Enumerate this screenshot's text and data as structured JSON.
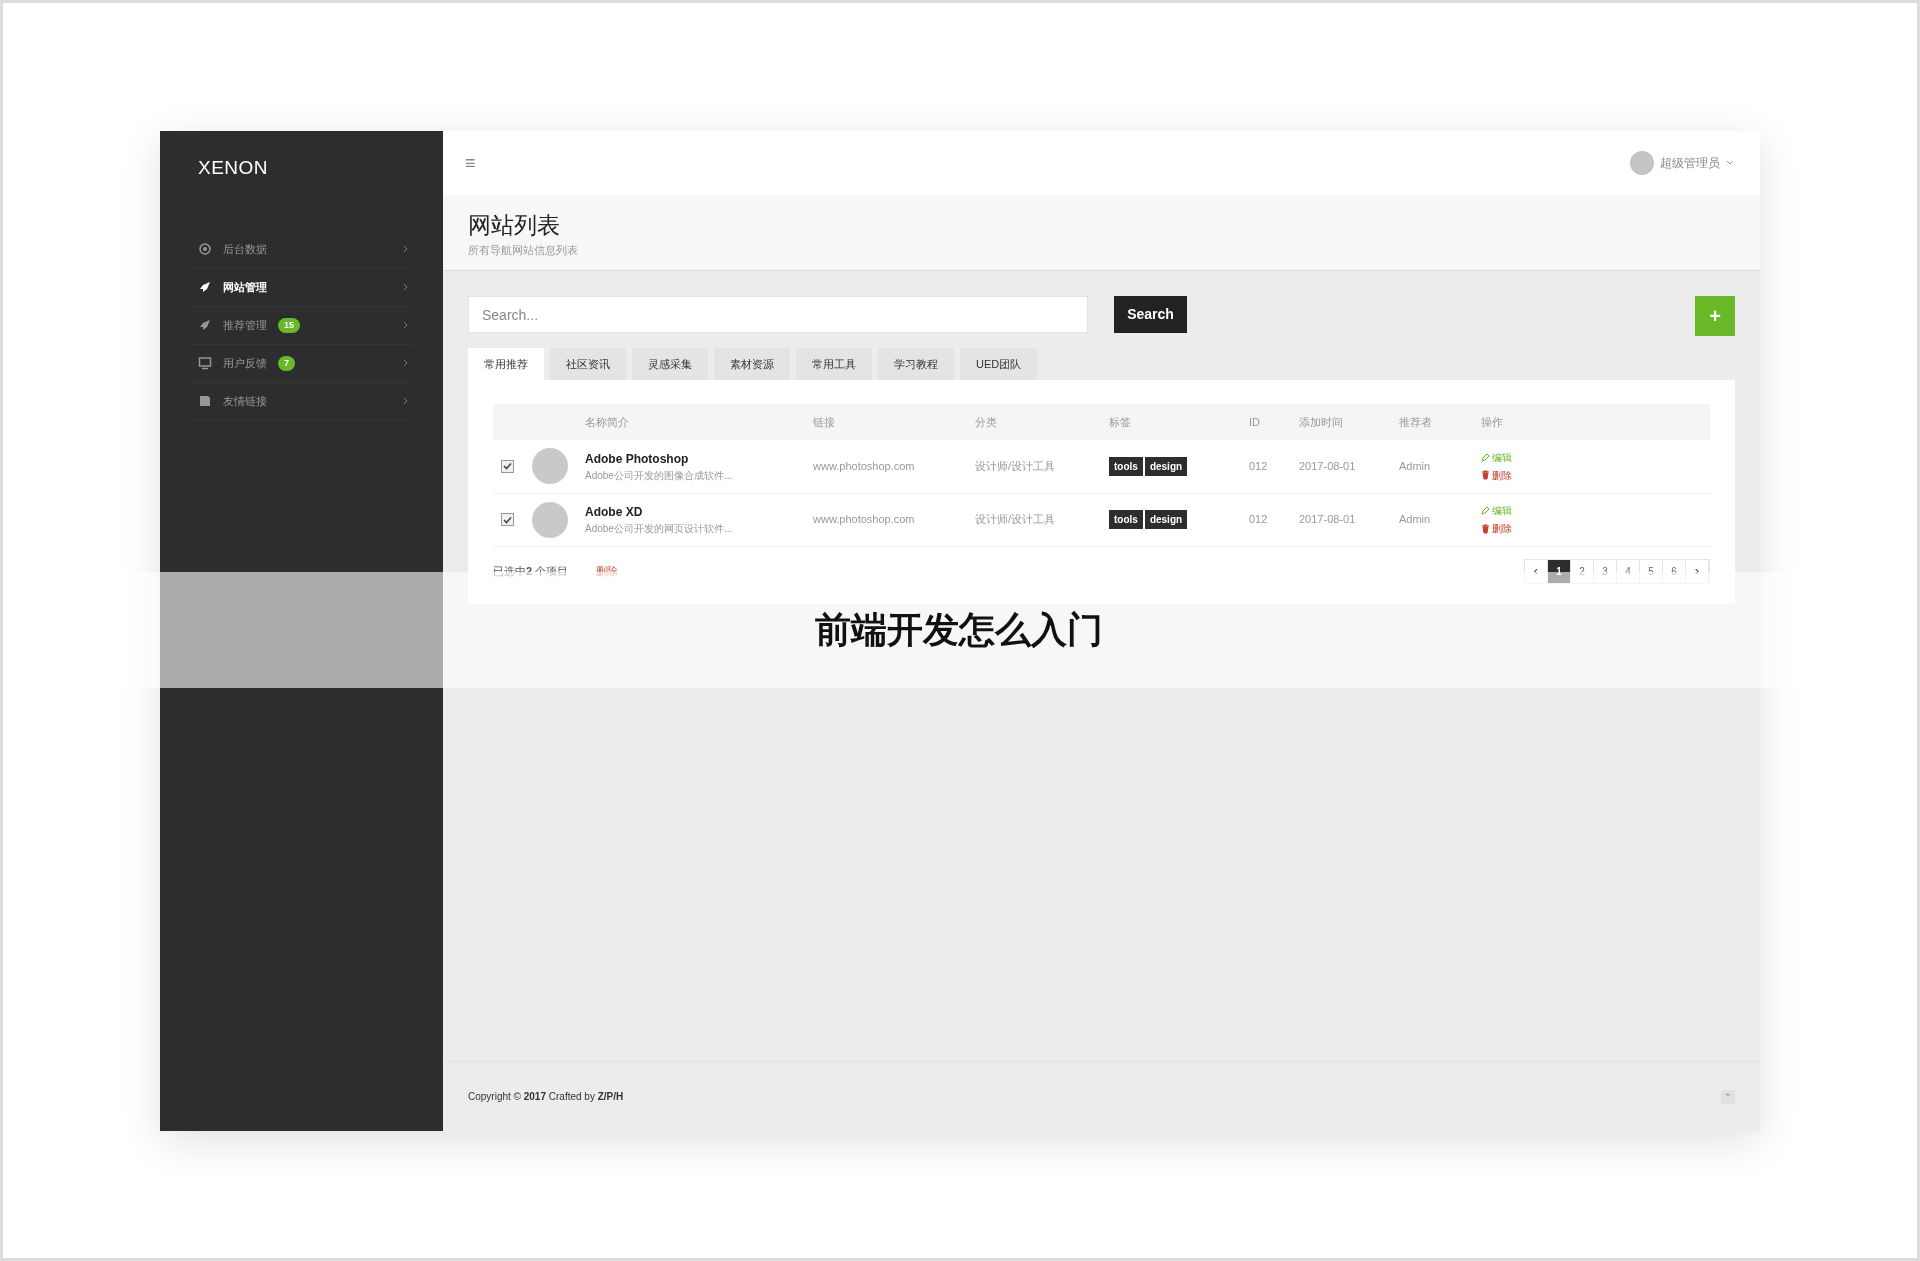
{
  "logo": "XENON",
  "sidebar": {
    "items": [
      {
        "label": "后台数据",
        "selected": false
      },
      {
        "label": "网站管理",
        "selected": true
      },
      {
        "label": "推荐管理",
        "selected": false,
        "badge": "15"
      },
      {
        "label": "用户反馈",
        "selected": false,
        "badge": "7"
      },
      {
        "label": "友情链接",
        "selected": false
      }
    ]
  },
  "header": {
    "menu_icon": "≡",
    "user": "超级管理员"
  },
  "page": {
    "title": "网站列表",
    "subtitle": "所有导航网站信息列表"
  },
  "search": {
    "placeholder": "Search...",
    "button": "Search",
    "add": "+"
  },
  "tabs": [
    {
      "label": "常用推荐",
      "selected": true
    },
    {
      "label": "社区资讯",
      "selected": false
    },
    {
      "label": "灵感采集",
      "selected": false
    },
    {
      "label": "素材资源",
      "selected": false
    },
    {
      "label": "常用工具",
      "selected": false
    },
    {
      "label": "学习教程",
      "selected": false
    },
    {
      "label": "UED团队",
      "selected": false
    }
  ],
  "table": {
    "columns": [
      "名称简介",
      "链接",
      "分类",
      "标签",
      "ID",
      "添加时间",
      "推荐者",
      "操作"
    ],
    "rows": [
      {
        "checked": true,
        "name": "Adobe Photoshop",
        "desc": "Adobe公司开发的图像合成软件...",
        "link": "www.photoshop.com",
        "category": "设计师/设计工具",
        "tags": [
          "tools",
          "design"
        ],
        "id": "012",
        "date": "2017-08-01",
        "by": "Admin",
        "edit": "编辑",
        "delete": "删除"
      },
      {
        "checked": true,
        "name": "Adobe XD",
        "desc": "Adobe公司开发的网页设计软件...",
        "link": "www.photoshop.com",
        "category": "设计师/设计工具",
        "tags": [
          "tools",
          "design"
        ],
        "id": "012",
        "date": "2017-08-01",
        "by": "Admin",
        "edit": "编辑",
        "delete": "删除"
      }
    ]
  },
  "selection": {
    "count_text": "已选中**2** 个项目",
    "delete": "删除"
  },
  "pagination": {
    "prev": "‹",
    "next": "›",
    "pages": [
      {
        "label": "1",
        "selected": true
      },
      {
        "label": "2",
        "selected": false
      },
      {
        "label": "3",
        "selected": false
      },
      {
        "label": "4",
        "selected": false
      },
      {
        "label": "5",
        "selected": false
      },
      {
        "label": "6",
        "selected": false
      }
    ]
  },
  "footer": {
    "copyright": "Copyright © **2017** Crafted by **Z/P/H**",
    "top": "⌃"
  },
  "banner": {
    "title": "前端开发怎么入门"
  }
}
